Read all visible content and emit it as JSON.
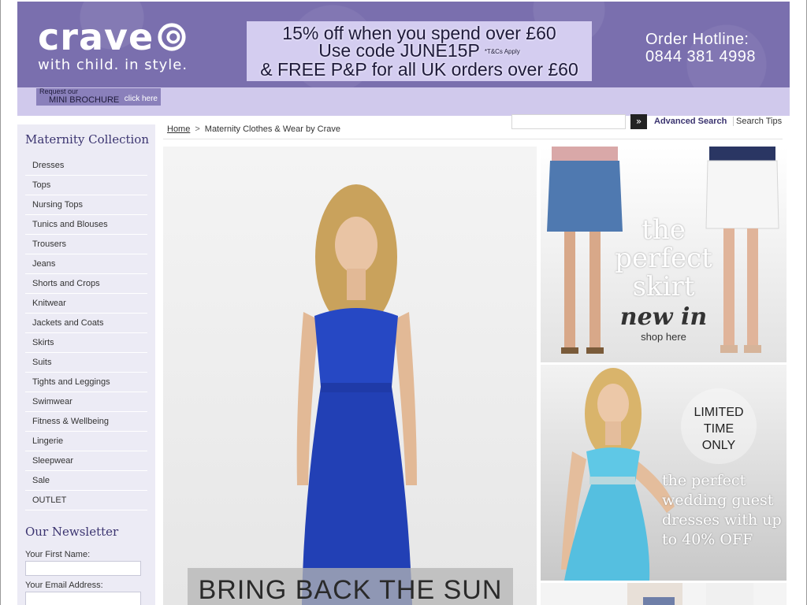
{
  "header": {
    "logo_text": "crave",
    "tagline": "with child. in style.",
    "promo": {
      "line1": "15% off when you spend over £60",
      "line2": "Use code JUNE15P",
      "tcs": "*T&Cs Apply",
      "line3": "& FREE P&P for all UK orders over £60"
    },
    "hotline": {
      "label": "Order Hotline:",
      "number": "0844 381 4998"
    },
    "brochure": {
      "line1": "Request our",
      "line2": "MINI BROCHURE",
      "cta": "click here"
    }
  },
  "search": {
    "placeholder": "",
    "go_icon": "»",
    "advanced": "Advanced Search",
    "tips": "Search Tips"
  },
  "breadcrumb": {
    "home": "Home",
    "separator": ">",
    "current": "Maternity Clothes & Wear by Crave"
  },
  "sidebar": {
    "title": "Maternity Collection",
    "categories": [
      "Dresses",
      "Tops",
      "Nursing Tops",
      "Tunics and Blouses",
      "Trousers",
      "Jeans",
      "Shorts and Crops",
      "Knitwear",
      "Jackets and Coats",
      "Skirts",
      "Suits",
      "Tights and Leggings",
      "Swimwear",
      "Fitness & Wellbeing",
      "Lingerie",
      "Sleepwear",
      "Sale",
      "OUTLET"
    ],
    "newsletter": {
      "title": "Our Newsletter",
      "first_name_label": "Your First Name:",
      "email_label": "Your Email Address:"
    }
  },
  "hero": {
    "caption": "BRING BACK THE SUN"
  },
  "banners": {
    "skirt": {
      "line1": "the",
      "line2": "perfect",
      "line3": "skirt",
      "line4": "new in",
      "cta": "shop here"
    },
    "wedding": {
      "limited1": "LIMITED",
      "limited2": "TIME",
      "limited3": "ONLY",
      "text": "the perfect wedding guest dresses with up to 40% OFF"
    }
  },
  "colors": {
    "header_bg": "#7a6fae",
    "subbar_bg": "#d0c9ec",
    "sidebar_bg": "#ecebf5",
    "heading_color": "#3b3470",
    "dress_blue": "#2648c4",
    "wedding_dress": "#5fc8e6"
  }
}
